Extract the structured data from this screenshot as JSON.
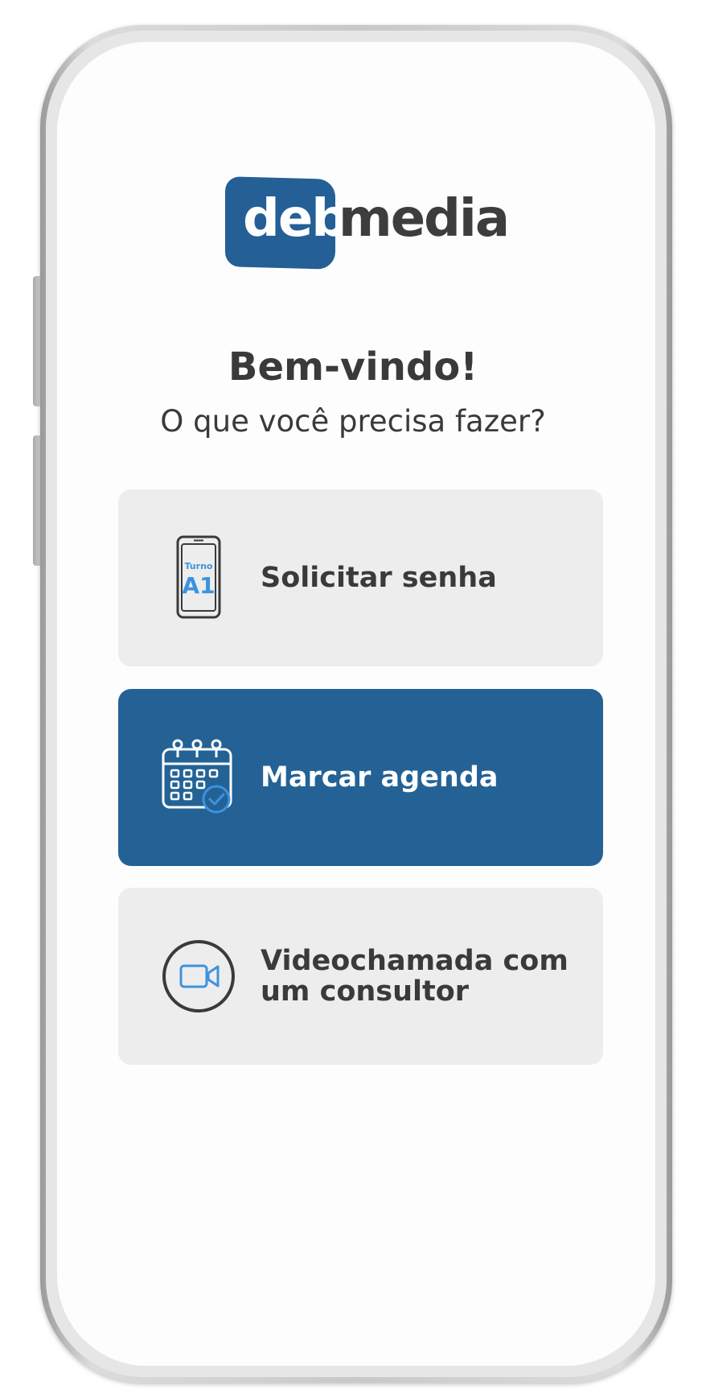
{
  "logo": {
    "part1": "deb",
    "part2": "media"
  },
  "welcome": {
    "title": "Bem-vindo!",
    "subtitle": "O que você precisa fazer?"
  },
  "options": [
    {
      "label": "Solicitar senha",
      "icon": "smartphone-ticket-icon",
      "icon_text_small": "Turno",
      "icon_text_large": "A1",
      "selected": false
    },
    {
      "label": "Marcar agenda",
      "icon": "calendar-check-icon",
      "selected": true
    },
    {
      "label": "Videochamada com um consultor",
      "label_line1": "Videochamada com",
      "label_line2": "um consultor",
      "icon": "video-camera-icon",
      "selected": false
    }
  ],
  "colors": {
    "brand_blue": "#245f96",
    "icon_blue": "#3b93e0",
    "text_dark": "#3a3a3a",
    "card_bg": "#ededed",
    "card_selected_bg": "#246296"
  }
}
